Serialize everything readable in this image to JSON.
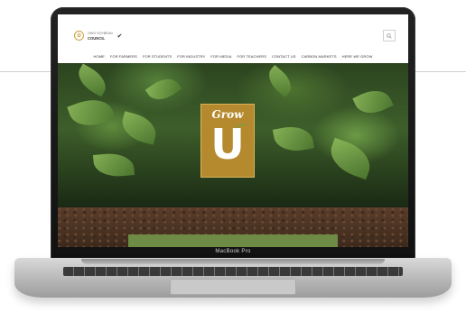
{
  "device": {
    "bezel_label": "MacBook Pro"
  },
  "header": {
    "logo": {
      "line1": "OHIO SOYBEAN",
      "line2": "COUNCIL",
      "icon": "soybean-icon",
      "check_icon": "checkmark-icon"
    },
    "search_icon": "search-icon"
  },
  "nav": {
    "items": [
      "HOME",
      "FOR FARMERS",
      "FOR STUDENTS",
      "FOR INDUSTRY",
      "FOR MEDIA",
      "FOR TEACHERS",
      "CONTACT US",
      "CARBON MARKETS",
      "HERE WE GROW"
    ]
  },
  "hero": {
    "badge_word": "Grow",
    "badge_letter": "U",
    "badge_color": "#b58a2e"
  },
  "colors": {
    "leaf_green": "#6b9a45",
    "soil_brown": "#4a3323",
    "bar_green": "#6d8b44"
  }
}
